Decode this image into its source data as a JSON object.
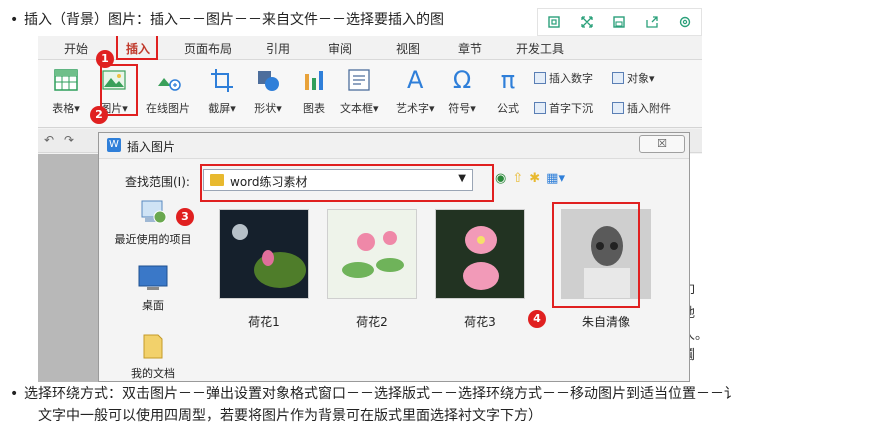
{
  "instructions": {
    "bullet": "•",
    "line1": "插入（背景）图片：插入－－图片－－来自文件－－选择要插入的图",
    "line2": "选择环绕方式：双击图片－－弹出设置对象格式窗口－－选择版式－－选择环绕方式－－移动图片到适当位置－－讠",
    "line3": "文字中一般可以使用四周型，若要将图片作为背景可在版式里面选择衬文字下方）"
  },
  "float_toolbar": {
    "icons": [
      "copy-icon",
      "expand-icon",
      "save-icon",
      "share-icon",
      "settings-icon"
    ],
    "color": "#2aa07a"
  },
  "menu": {
    "items": [
      "开始",
      "插入",
      "页面布局",
      "引用",
      "审阅",
      "视图",
      "章节",
      "开发工具"
    ],
    "active": "插入"
  },
  "ribbon": {
    "table": "表格",
    "picture": "图片",
    "online_picture": "在线图片",
    "screenshot": "截屏",
    "shapes": "形状",
    "chart": "图表",
    "textbox": "文本框",
    "wordart": "艺术字",
    "symbol": "符号",
    "formula": "公式",
    "insert_number": "插入数字",
    "object": "对象",
    "drop_cap": "首字下沉",
    "attachment": "插入附件",
    "symbol_glyph": "Ω",
    "formula_glyph": "π",
    "wordart_glyph": "A",
    "dropdown": "▾"
  },
  "dialog": {
    "title": "插入图片",
    "close_glyph": "☒",
    "look_in_label": "查找范围(I):",
    "look_in_value": "word练习素材",
    "places": [
      "最近使用的项目",
      "桌面",
      "我的文档"
    ],
    "files": [
      "荷花1",
      "荷花2",
      "荷花3",
      "朱自清像"
    ]
  },
  "doc_side_text": [
    "叩",
    "地",
    "人。",
    "鬮",
    "讠"
  ],
  "badges": [
    "1",
    "2",
    "3",
    "4"
  ],
  "colors": {
    "annotation_red": "#e02020",
    "wps_blue": "#2f7fd9",
    "folder_yellow": "#e8b92f"
  }
}
